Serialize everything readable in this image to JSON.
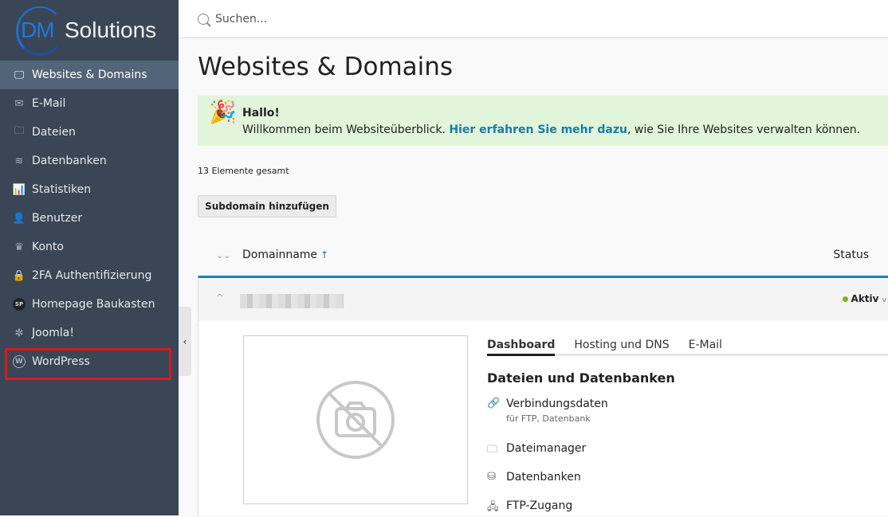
{
  "logo": {
    "text_dm": "DM",
    "text_solutions": "Solutions"
  },
  "sidebar": {
    "items": [
      {
        "label": "Websites & Domains",
        "icon": "monitor-icon",
        "active": true
      },
      {
        "label": "E-Mail",
        "icon": "mail-icon"
      },
      {
        "label": "Dateien",
        "icon": "folder-icon"
      },
      {
        "label": "Datenbanken",
        "icon": "layers-icon"
      },
      {
        "label": "Statistiken",
        "icon": "bar-chart-icon"
      },
      {
        "label": "Benutzer",
        "icon": "user-icon"
      },
      {
        "label": "Konto",
        "icon": "crown-icon"
      },
      {
        "label": "2FA Authentifizierung",
        "icon": "lock-2fa-icon"
      },
      {
        "label": "Homepage Baukasten",
        "icon": "sp-icon"
      },
      {
        "label": "Joomla!",
        "icon": "joomla-icon"
      },
      {
        "label": "WordPress",
        "icon": "wordpress-icon"
      }
    ],
    "highlight_color": "#e0161e"
  },
  "search": {
    "placeholder": "Suchen..."
  },
  "page": {
    "title": "Websites & Domains"
  },
  "banner": {
    "title": "Hallo!",
    "text_before": "Willkommen beim Websiteüberblick. ",
    "link": "Hier erfahren Sie mehr dazu",
    "text_after": ", wie Sie Ihre Websites verwalten können."
  },
  "count": "13 Elemente gesamt",
  "add_subdomain": "Subdomain hinzufügen",
  "table": {
    "col_domain": "Domainname",
    "sort_arrow": "↑",
    "col_status": "Status"
  },
  "row": {
    "status": "Aktiv",
    "status_color": "#7cb518"
  },
  "tabs": [
    "Dashboard",
    "Hosting und DNS",
    "E-Mail"
  ],
  "section": "Dateien und Datenbanken",
  "links": [
    {
      "label": "Verbindungsdaten",
      "sub": "für FTP, Datenbank",
      "icon": "link-icon"
    },
    {
      "label": "Dateimanager",
      "icon": "folder-icon"
    },
    {
      "label": "Datenbanken",
      "icon": "database-icon"
    },
    {
      "label": "FTP-Zugang",
      "icon": "network-icon"
    }
  ]
}
